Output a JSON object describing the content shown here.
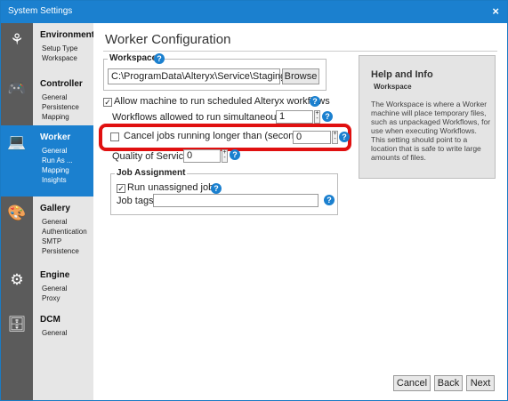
{
  "window": {
    "title": "System Settings",
    "close_glyph": "×"
  },
  "nav": [
    {
      "heading": "Environment",
      "items": [
        "Setup Type",
        "Workspace"
      ],
      "icon": "leaf-icon",
      "glyph": "⚘",
      "active": false
    },
    {
      "heading": "Controller",
      "items": [
        "General",
        "Persistence",
        "Mapping"
      ],
      "icon": "gamepad-icon",
      "glyph": "🎮",
      "active": false
    },
    {
      "heading": "Worker",
      "items": [
        "General",
        "Run As ...",
        "Mapping",
        "Insights"
      ],
      "icon": "monitor-icon",
      "glyph": "💻",
      "active": true
    },
    {
      "heading": "Gallery",
      "items": [
        "General",
        "Authentication",
        "SMTP",
        "Persistence"
      ],
      "icon": "palette-icon",
      "glyph": "🎨",
      "active": false
    },
    {
      "heading": "Engine",
      "items": [
        "General",
        "Proxy"
      ],
      "icon": "engine-icon",
      "glyph": "⚙",
      "active": false
    },
    {
      "heading": "DCM",
      "items": [
        "General"
      ],
      "icon": "database-icon",
      "glyph": "🗄",
      "active": false
    }
  ],
  "main": {
    "title": "Worker Configuration",
    "workspace": {
      "legend": "Workspace",
      "path": "C:\\ProgramData\\Alteryx\\Service\\Staging",
      "browse": "Browse"
    },
    "allow_workflows": {
      "label": "Allow machine to run scheduled Alteryx workflows",
      "checked": true,
      "glyph": "✓"
    },
    "simultaneous": {
      "label": "Workflows allowed to run simultaneously:",
      "value": "1"
    },
    "cancel_jobs": {
      "label": "Cancel jobs running longer than (seconds)",
      "checked": false,
      "value": "0"
    },
    "quality": {
      "label": "Quality of Service",
      "value": "0"
    },
    "job_assignment": {
      "legend": "Job Assignment",
      "unassigned_label": "Run unassigned jobs",
      "unassigned_checked": true,
      "glyph": "✓",
      "tags_label": "Job tags",
      "tags_value": ""
    },
    "help_glyph": "?",
    "spin_up": "+",
    "spin_down": "-",
    "highlight_color": "#e01010"
  },
  "help": {
    "title": "Help and Info",
    "subtitle": "Workspace",
    "body": "The Workspace is where a Worker machine will place temporary files, such as unpackaged Workflows, for use when executing Workflows. This setting should point to a location that is safe to write large amounts of files."
  },
  "footer": {
    "cancel": "Cancel",
    "back": "Back",
    "next": "Next"
  }
}
